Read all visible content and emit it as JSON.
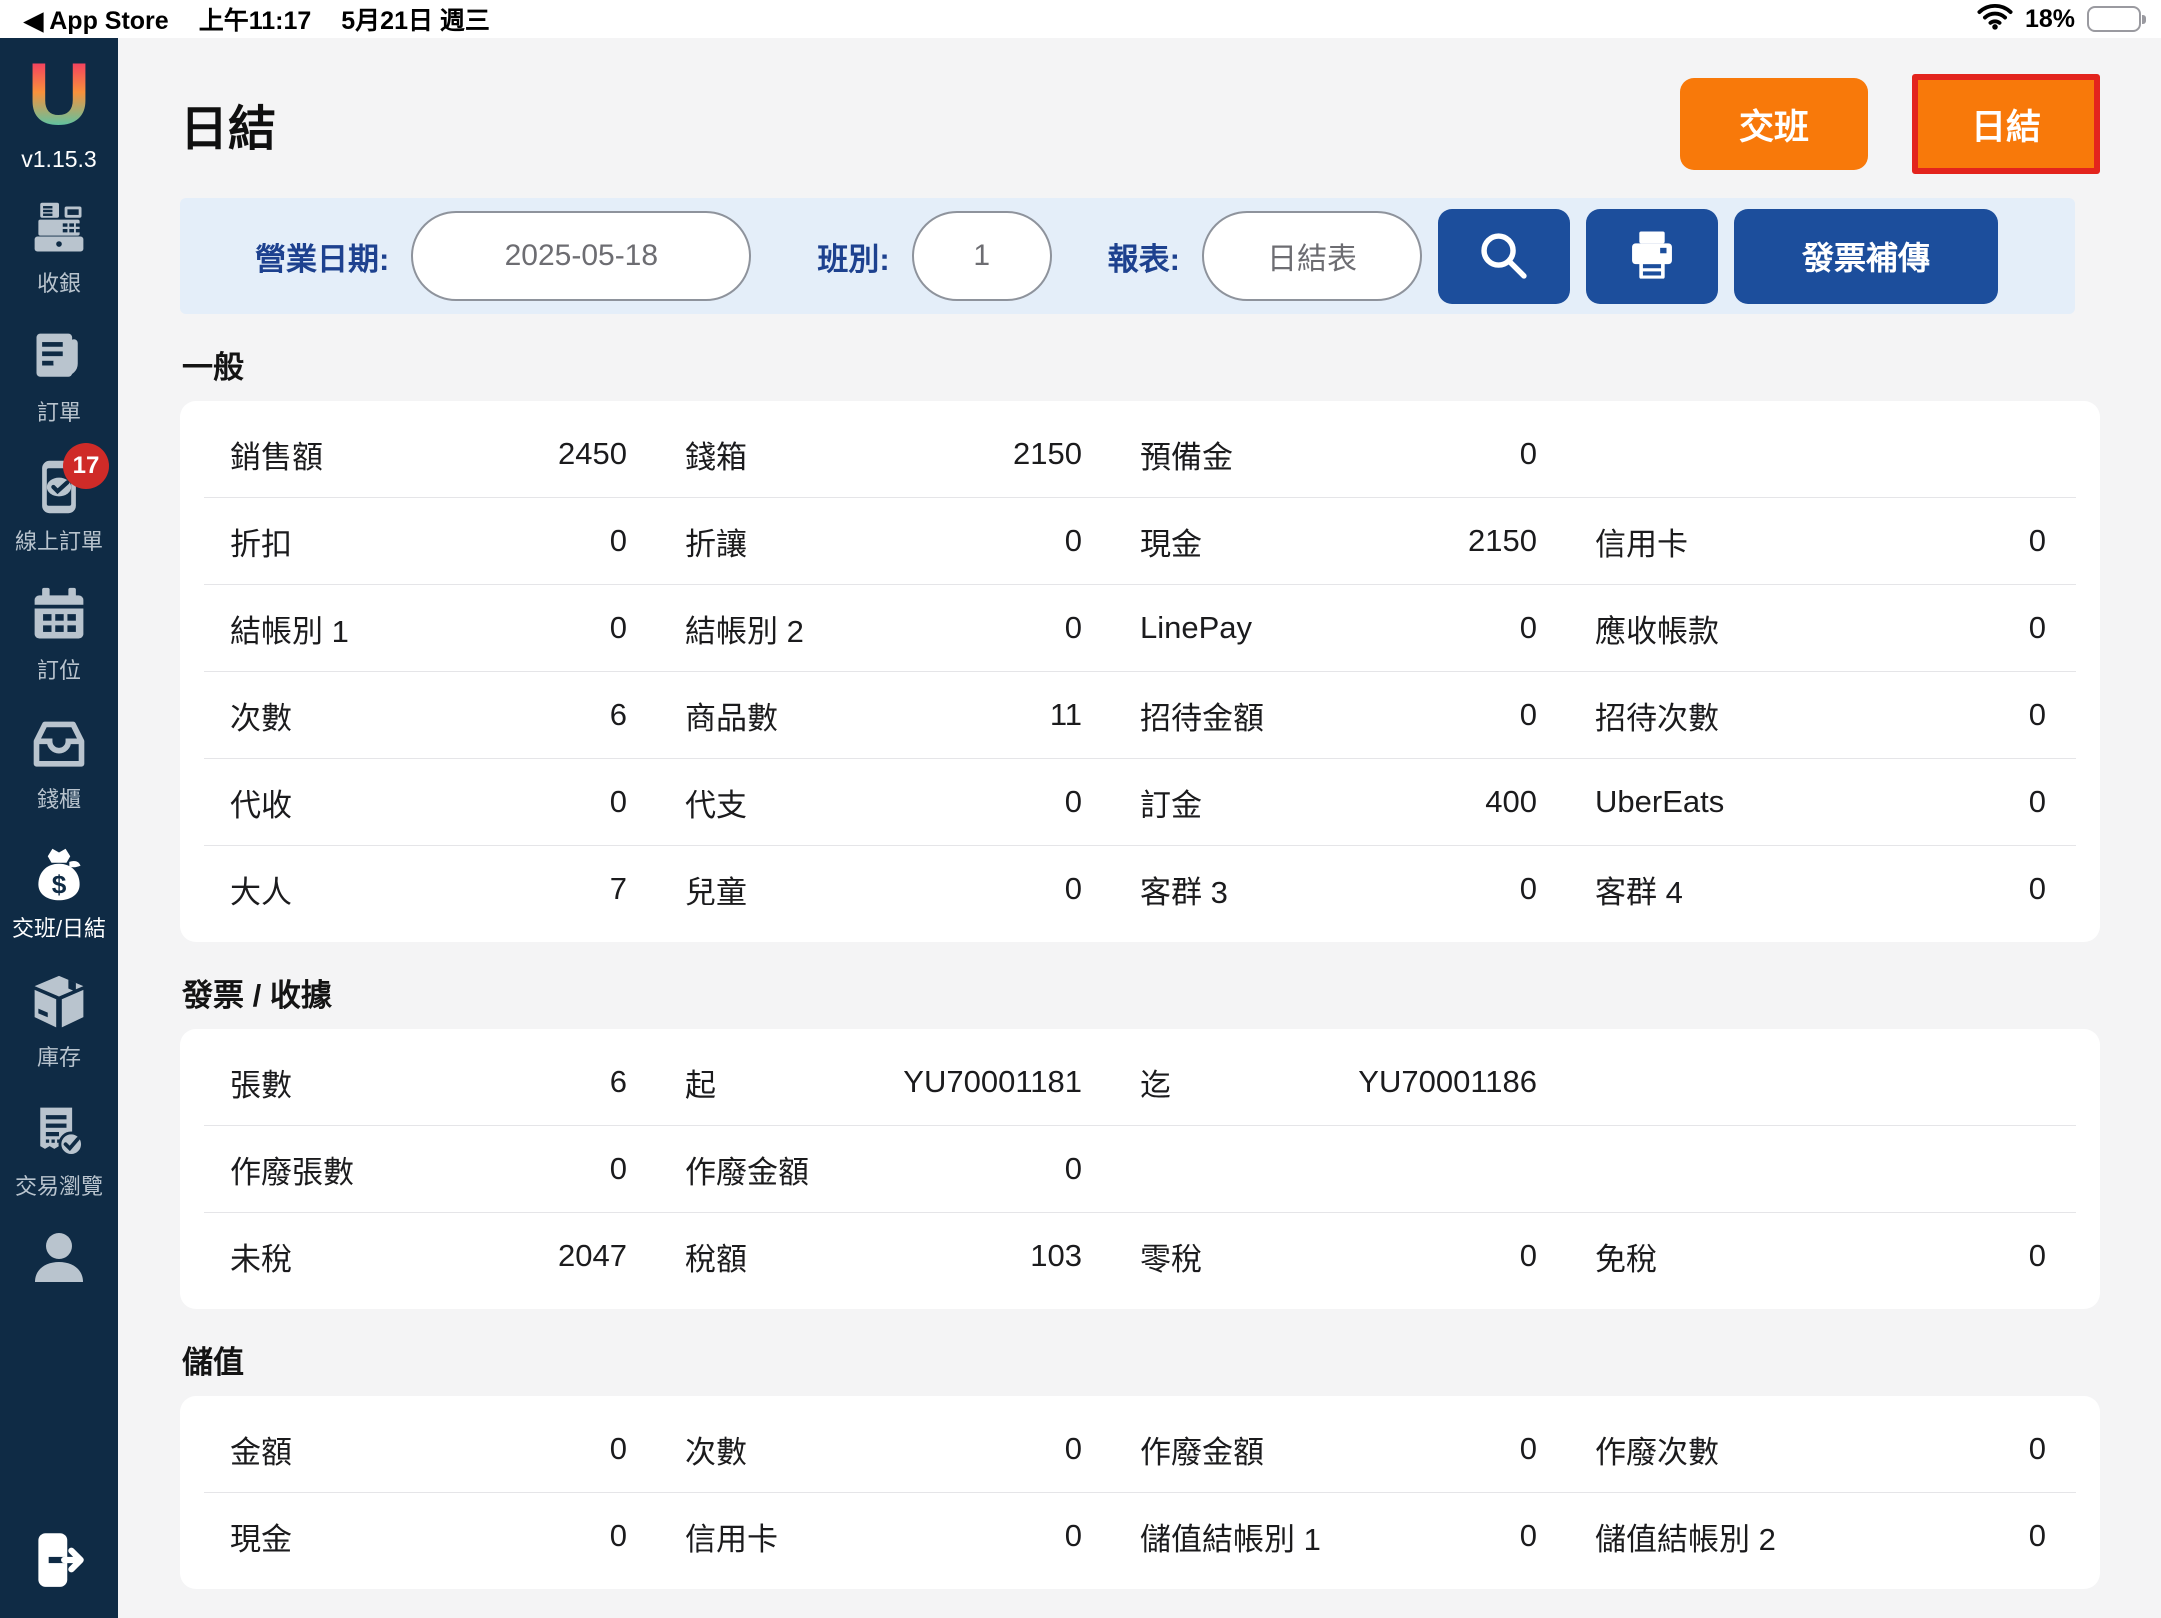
{
  "status_bar": {
    "back_label": "◀ App Store",
    "time": "上午11:17",
    "date": "5月21日 週三",
    "battery": "18%",
    "battery_percent": 18
  },
  "sidebar": {
    "logo_letter": "U",
    "version": "v1.15.3",
    "items": [
      {
        "key": "cashier",
        "icon": "cash-register",
        "label": "收銀",
        "active": false
      },
      {
        "key": "orders",
        "icon": "order",
        "label": "訂單",
        "active": false
      },
      {
        "key": "online-orders",
        "icon": "online-order",
        "label": "線上訂單",
        "active": false,
        "badge": "17"
      },
      {
        "key": "reservation",
        "icon": "calendar",
        "label": "訂位",
        "active": false
      },
      {
        "key": "cash-drawer",
        "icon": "drawer",
        "label": "錢櫃",
        "active": false
      },
      {
        "key": "shift-daily",
        "icon": "money-bag",
        "label": "交班/日結",
        "active": true
      },
      {
        "key": "inventory",
        "icon": "box",
        "label": "庫存",
        "active": false
      },
      {
        "key": "transactions",
        "icon": "receipt-check",
        "label": "交易瀏覽",
        "active": false
      }
    ]
  },
  "header": {
    "title": "日結",
    "shift_button": "交班",
    "daily_button": "日結"
  },
  "filter": {
    "business_date_label": "營業日期:",
    "business_date": "2025-05-18",
    "shift_label": "班別:",
    "shift": "1",
    "report_label": "報表:",
    "report": "日結表",
    "resend_label": "發票補傳"
  },
  "colors": {
    "sidebar_navy": "#0f2b45",
    "accent_orange": "#f8790a",
    "selected_border_red": "#e3241d",
    "button_blue": "#1c4e9c",
    "filter_bg": "#e4eef9",
    "badge_red": "#cf2b28"
  },
  "sections": [
    {
      "title": "一般",
      "rows": [
        [
          {
            "label": "銷售額",
            "value": "2450"
          },
          {
            "label": "錢箱",
            "value": "2150"
          },
          {
            "label": "預備金",
            "value": "0"
          },
          {
            "label": "",
            "value": ""
          }
        ],
        [
          {
            "label": "折扣",
            "value": "0"
          },
          {
            "label": "折讓",
            "value": "0"
          },
          {
            "label": "現金",
            "value": "2150"
          },
          {
            "label": "信用卡",
            "value": "0"
          }
        ],
        [
          {
            "label": "結帳別 1",
            "value": "0"
          },
          {
            "label": "結帳別 2",
            "value": "0"
          },
          {
            "label": "LinePay",
            "value": "0"
          },
          {
            "label": "應收帳款",
            "value": "0"
          }
        ],
        [
          {
            "label": "次數",
            "value": "6"
          },
          {
            "label": "商品數",
            "value": "11"
          },
          {
            "label": "招待金額",
            "value": "0"
          },
          {
            "label": "招待次數",
            "value": "0"
          }
        ],
        [
          {
            "label": "代收",
            "value": "0"
          },
          {
            "label": "代支",
            "value": "0"
          },
          {
            "label": "訂金",
            "value": "400"
          },
          {
            "label": "UberEats",
            "value": "0"
          }
        ],
        [
          {
            "label": "大人",
            "value": "7"
          },
          {
            "label": "兒童",
            "value": "0"
          },
          {
            "label": "客群 3",
            "value": "0"
          },
          {
            "label": "客群 4",
            "value": "0"
          }
        ]
      ]
    },
    {
      "title": "發票 / 收據",
      "rows": [
        [
          {
            "label": "張數",
            "value": "6"
          },
          {
            "label": "起",
            "value": "YU70001181"
          },
          {
            "label": "迄",
            "value": "YU70001186"
          },
          {
            "label": "",
            "value": ""
          }
        ],
        [
          {
            "label": "作廢張數",
            "value": "0"
          },
          {
            "label": "作廢金額",
            "value": "0"
          },
          {
            "label": "",
            "value": ""
          },
          {
            "label": "",
            "value": ""
          }
        ],
        [
          {
            "label": "未稅",
            "value": "2047"
          },
          {
            "label": "稅額",
            "value": "103"
          },
          {
            "label": "零稅",
            "value": "0"
          },
          {
            "label": "免稅",
            "value": "0"
          }
        ]
      ]
    },
    {
      "title": "儲值",
      "rows": [
        [
          {
            "label": "金額",
            "value": "0"
          },
          {
            "label": "次數",
            "value": "0"
          },
          {
            "label": "作廢金額",
            "value": "0"
          },
          {
            "label": "作廢次數",
            "value": "0"
          }
        ],
        [
          {
            "label": "現金",
            "value": "0"
          },
          {
            "label": "信用卡",
            "value": "0"
          },
          {
            "label": "儲值結帳別 1",
            "value": "0"
          },
          {
            "label": "儲值結帳別 2",
            "value": "0"
          }
        ]
      ]
    }
  ]
}
